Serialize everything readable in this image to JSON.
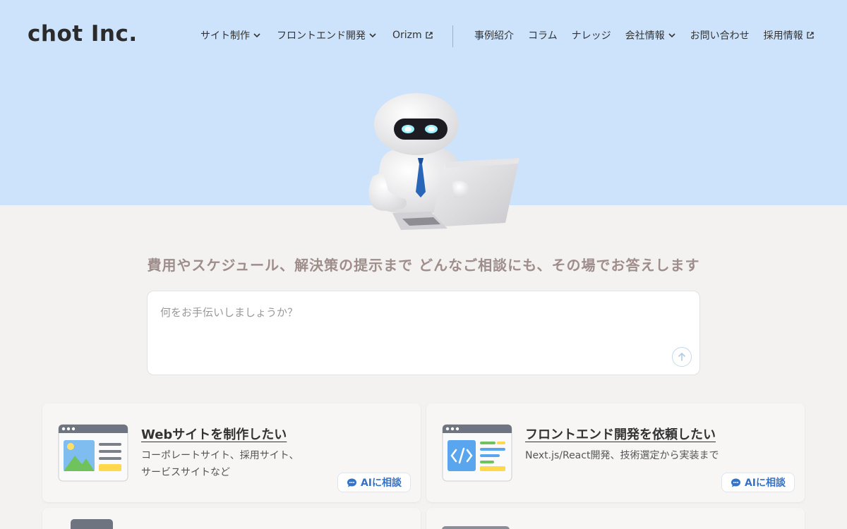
{
  "brand": {
    "logo_text": "chot Inc."
  },
  "nav": {
    "primary": [
      {
        "label": "サイト制作",
        "icon": "chevron-down-icon"
      },
      {
        "label": "フロントエンド開発",
        "icon": "chevron-down-icon"
      },
      {
        "label": "Orizm",
        "icon": "external-link-icon"
      }
    ],
    "secondary": [
      {
        "label": "事例紹介"
      },
      {
        "label": "コラム"
      },
      {
        "label": "ナレッジ"
      },
      {
        "label": "会社情報",
        "icon": "chevron-down-icon"
      },
      {
        "label": "お問い合わせ"
      },
      {
        "label": "採用情報",
        "icon": "external-link-icon"
      }
    ]
  },
  "hero": {
    "headline": "費用やスケジュール、解決策の提示まで どんなご相談にも、その場でお答えします",
    "chat_placeholder": "何をお手伝いしましょうか？",
    "chat_value": ""
  },
  "cards": [
    {
      "title": "Webサイトを制作したい",
      "desc_line1": "コーポレートサイト、採用サイト、",
      "desc_line2": "サービスサイトなど",
      "button": "AIに相談",
      "icon": "website-window-icon"
    },
    {
      "title": "フロントエンド開発を依頼したい",
      "desc_line1": "Next.js/React開発、技術選定から実装まで",
      "desc_line2": "",
      "button": "AIに相談",
      "icon": "code-window-icon"
    }
  ],
  "colors": {
    "hero_bg": "#cde3fc",
    "page_bg": "#f3f2f0",
    "headline": "#9e8d8a",
    "accent": "#3573c9"
  }
}
